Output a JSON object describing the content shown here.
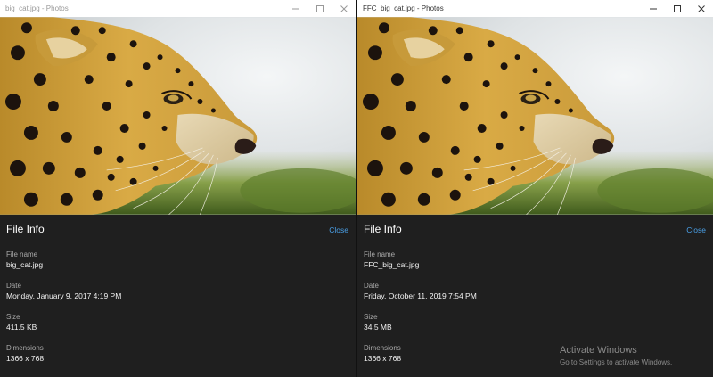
{
  "left": {
    "title": "big_cat.jpg - Photos",
    "info": {
      "heading": "File Info",
      "close": "Close",
      "fields": [
        {
          "label": "File name",
          "value": "big_cat.jpg"
        },
        {
          "label": "Date",
          "value": "Monday, January 9, 2017 4:19 PM"
        },
        {
          "label": "Size",
          "value": "411.5 KB"
        },
        {
          "label": "Dimensions",
          "value": "1366 x 768"
        }
      ]
    }
  },
  "right": {
    "title": "FFC_big_cat.jpg - Photos",
    "info": {
      "heading": "File Info",
      "close": "Close",
      "fields": [
        {
          "label": "File name",
          "value": "FFC_big_cat.jpg"
        },
        {
          "label": "Date",
          "value": "Friday, October 11, 2019 7:54 PM"
        },
        {
          "label": "Size",
          "value": "34.5 MB"
        },
        {
          "label": "Dimensions",
          "value": "1366 x 768"
        }
      ]
    }
  },
  "watermark": {
    "title": "Activate Windows",
    "subtitle": "Go to Settings to activate Windows."
  },
  "colors": {
    "accent": "#4aa0e8",
    "panel_bg": "#1f1f1f",
    "active_border": "#3c6fd0"
  },
  "icons": {
    "minimize": "minimize-icon",
    "maximize": "maximize-icon",
    "close": "close-icon"
  }
}
